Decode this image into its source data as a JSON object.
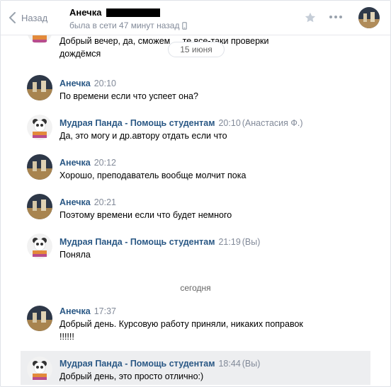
{
  "header": {
    "back_label": "Назад",
    "contact_name": "Анечка",
    "status": "была в сети 47 минут назад"
  },
  "date_pill": "15 июня",
  "date_today": "сегодня",
  "messages": [
    {
      "name": "",
      "time": "",
      "who": "",
      "lines": [
        "Добрый вечер, да, сможем ... те все-таки проверки",
        "дождёмся"
      ]
    },
    {
      "name": "Анечка",
      "time": "20:10",
      "who": "",
      "lines": [
        "По времени если что успеет она?"
      ]
    },
    {
      "name": "Мудрая Панда - Помощь студентам",
      "time": "20:10",
      "who": "(Анастасия Ф.)",
      "lines": [
        "Да, это могу и др.автору отдать если что"
      ]
    },
    {
      "name": "Анечка",
      "time": "20:12",
      "who": "",
      "lines": [
        "Хорошо, преподаватель вообще молчит пока"
      ]
    },
    {
      "name": "Анечка",
      "time": "20:21",
      "who": "",
      "lines": [
        "Поэтому времени если что будет немного"
      ]
    },
    {
      "name": "Мудрая Панда - Помощь студентам",
      "time": "21:19",
      "who": "(Вы)",
      "lines": [
        "Поняла"
      ]
    },
    {
      "name": "Анечка",
      "time": "17:37",
      "who": "",
      "lines": [
        "Добрый день. Курсовую работу приняли, никаких поправок",
        "!!!!!!"
      ]
    },
    {
      "name": "Мудрая Панда - Помощь студентам",
      "time": "18:44",
      "who": "(Вы)",
      "lines": [
        "Добрый день, это просто отлично:)"
      ]
    }
  ]
}
